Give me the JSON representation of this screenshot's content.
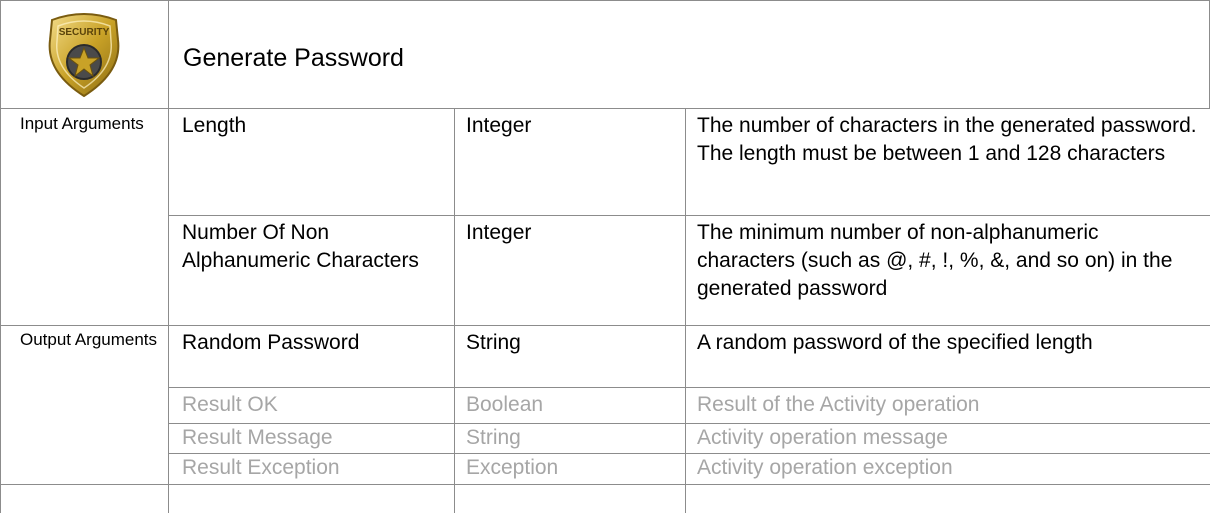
{
  "header": {
    "title": "Generate Password",
    "logo_text": "SECURITY"
  },
  "sections": [
    {
      "label": "Input Arguments",
      "rows": [
        {
          "name": "Length",
          "type": "Integer",
          "description": "The number of characters in the generated password. The length must be between 1 and 128 characters"
        },
        {
          "name": "Number Of Non Alphanumeric Characters",
          "type": "Integer",
          "description": "The minimum number of non-alphanumeric characters (such as @, #, !, %, &, and so on) in the generated password"
        }
      ]
    },
    {
      "label": "Output Arguments",
      "rows": [
        {
          "name": "Random Password",
          "type": "String",
          "description": "A random password of the specified length"
        },
        {
          "name": "Result OK",
          "type": "Boolean",
          "description": "Result of the Activity operation"
        },
        {
          "name": "Result Message",
          "type": "String",
          "description": "Activity operation message"
        },
        {
          "name": "Result Exception",
          "type": "Exception",
          "description": "Activity operation exception"
        }
      ]
    }
  ],
  "colors": {
    "grid": "#8c8c8c",
    "muted_text": "#a6a6a6",
    "badge_gold": "#c9a227",
    "badge_star": "#3a3a3a"
  }
}
